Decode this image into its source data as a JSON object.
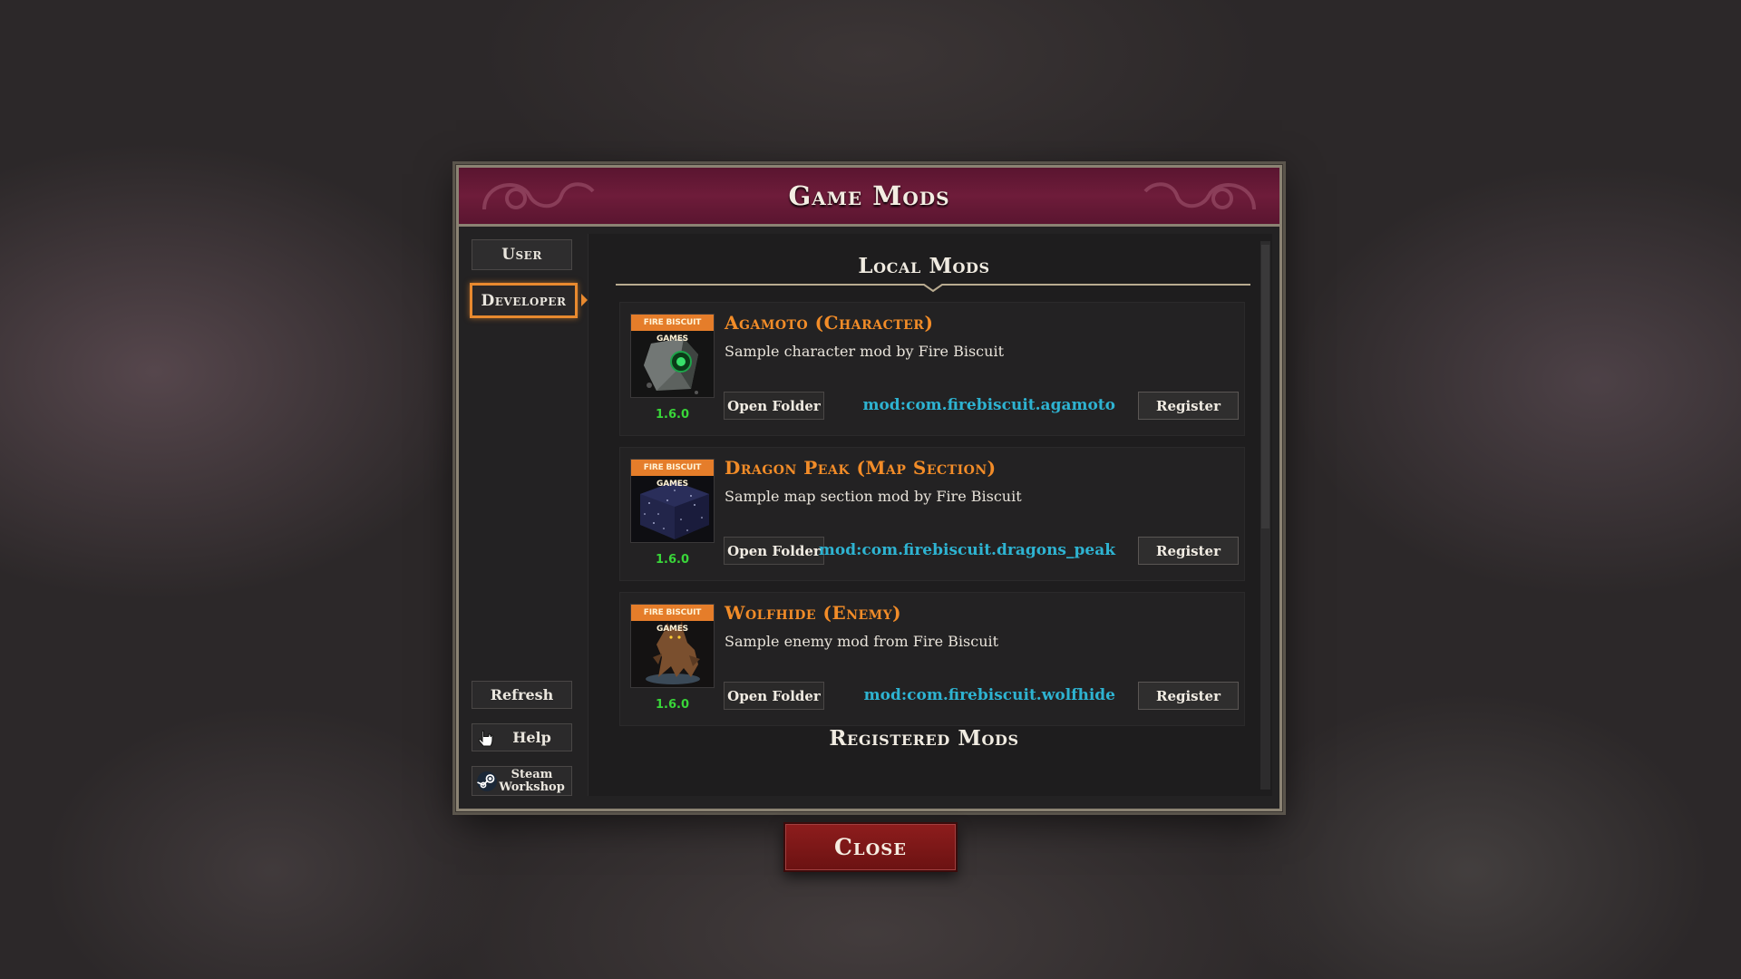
{
  "dialog": {
    "title": "Game Mods"
  },
  "sidebar": {
    "tabs": [
      {
        "label": "User",
        "selected": false
      },
      {
        "label": "Developer",
        "selected": true
      }
    ],
    "refresh_label": "Refresh",
    "help_label": "Help",
    "steam_label_line1": "Steam",
    "steam_label_line2": "Workshop"
  },
  "main": {
    "local_heading": "Local Mods",
    "registered_heading": "Registered Mods",
    "mods": [
      {
        "title": "Agamoto (Character)",
        "description": "Sample character mod by Fire Biscuit",
        "version": "1.6.0",
        "mod_id": "mod:com.firebiscuit.agamoto",
        "thumb_banner": "FIRE BISCUIT GAMES",
        "thumb_icon": "gem-cube-icon",
        "open_folder_label": "Open Folder",
        "register_label": "Register"
      },
      {
        "title": "Dragon Peak (Map Section)",
        "description": "Sample map section mod by Fire Biscuit",
        "version": "1.6.0",
        "mod_id": "mod:com.firebiscuit.dragons_peak",
        "thumb_banner": "FIRE BISCUIT GAMES",
        "thumb_icon": "starry-cube-icon",
        "open_folder_label": "Open Folder",
        "register_label": "Register"
      },
      {
        "title": "Wolfhide (Enemy)",
        "description": "Sample enemy mod from Fire Biscuit",
        "version": "1.6.0",
        "mod_id": "mod:com.firebiscuit.wolfhide",
        "thumb_banner": "FIRE BISCUIT GAMES",
        "thumb_icon": "wolf-creature-icon",
        "open_folder_label": "Open Folder",
        "register_label": "Register"
      }
    ]
  },
  "close_label": "Close",
  "colors": {
    "title_bar": "#6e1c3a",
    "accent_orange": "#f28c28",
    "mod_id": "#2eb3d1",
    "version": "#39d639",
    "close_button": "#8e1d1d"
  }
}
